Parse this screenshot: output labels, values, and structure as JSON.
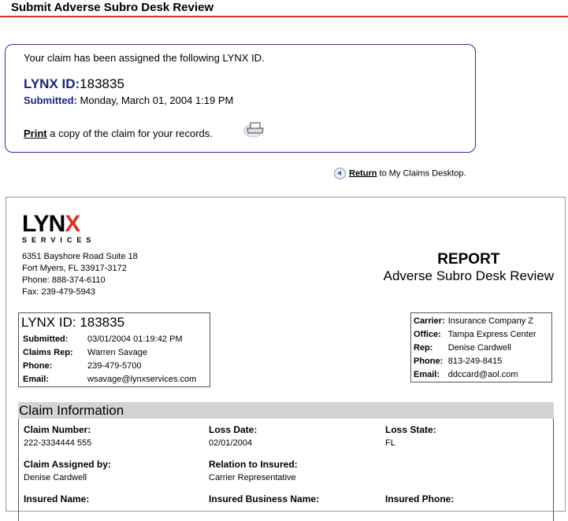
{
  "page_title": "Submit Adverse Subro Desk Review",
  "confirmation": {
    "intro": "Your claim has been assigned the following LYNX ID.",
    "lynx_id_label": "LYNX ID:",
    "lynx_id": "183835",
    "submitted_label": "Submitted:",
    "submitted_value": "Monday, March 01, 2004 1:19 PM",
    "print_link": "Print",
    "print_text": "a copy of the claim for your records."
  },
  "return": {
    "link": "Return",
    "text": "to My Claims Desktop."
  },
  "report": {
    "logo_word": "LYNX",
    "logo_sub": "SERVICES",
    "address": [
      "6351 Bayshore Road Suite 18",
      "Fort Myers, FL 33917-3172",
      "Phone: 888-374-6110",
      "Fax: 239-479-5943"
    ],
    "title": "REPORT",
    "subtitle": "Adverse Subro Desk Review",
    "id_box": {
      "heading": "LYNX ID: 183835",
      "rows": [
        {
          "k": "Submitted:",
          "v": "03/01/2004 01:19:42 PM"
        },
        {
          "k": "Claims Rep:",
          "v": "Warren Savage"
        },
        {
          "k": "Phone:",
          "v": "239-479-5700"
        },
        {
          "k": "Email:",
          "v": "wsavage@lynxservices.com"
        }
      ]
    },
    "carrier_box": {
      "rows": [
        {
          "k": "Carrier:",
          "v": "Insurance Company Z"
        },
        {
          "k": "Office:",
          "v": "Tampa Express Center"
        },
        {
          "k": "Rep:",
          "v": "Denise Cardwell"
        },
        {
          "k": "Phone:",
          "v": "813-249-8415"
        },
        {
          "k": "Email:",
          "v": "ddccard@aol.com"
        }
      ]
    },
    "claim_info": {
      "heading": "Claim Information",
      "fields": [
        {
          "label": "Claim Number:",
          "value": "222-3334444 555"
        },
        {
          "label": "Loss Date:",
          "value": "02/01/2004"
        },
        {
          "label": "Loss State:",
          "value": "FL"
        },
        {
          "label": "Claim Assigned by:",
          "value": "Denise Cardwell"
        },
        {
          "label": "Relation to Insured:",
          "value": "Carrier Representative"
        },
        {
          "label": "Insured Name:",
          "value": ""
        },
        {
          "label": "Insured Business Name:",
          "value": ""
        },
        {
          "label": "Insured Phone:",
          "value": ""
        }
      ]
    }
  }
}
